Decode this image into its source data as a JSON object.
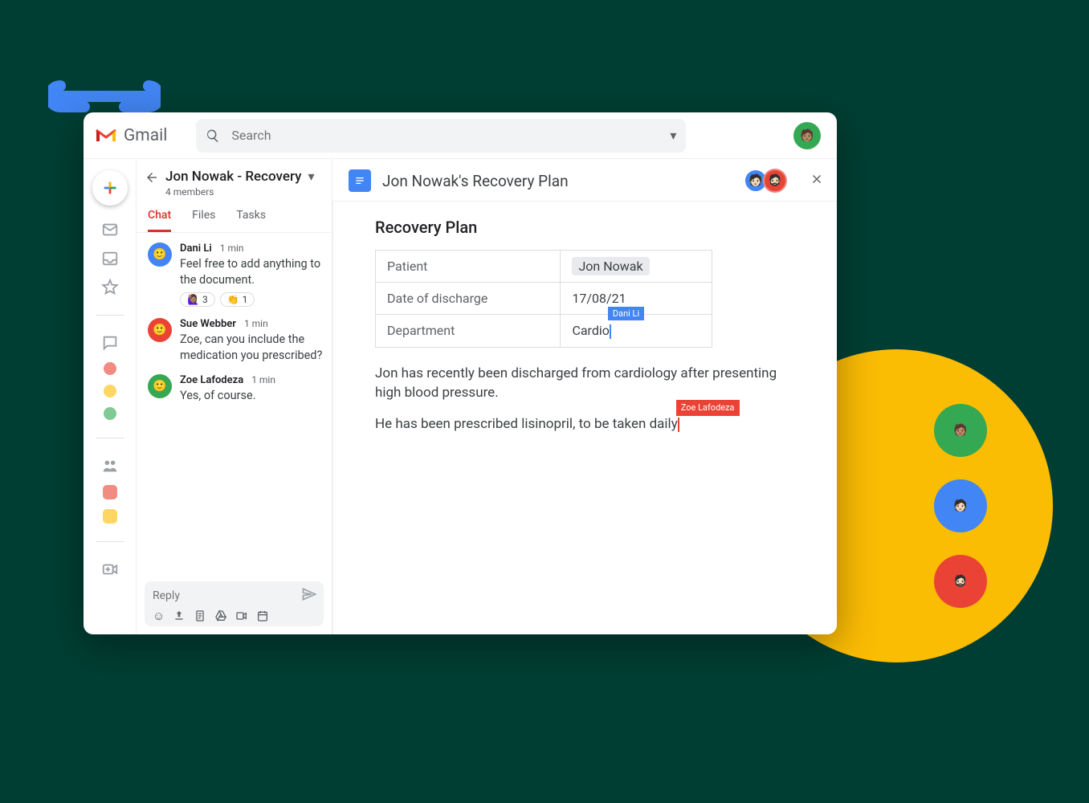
{
  "header": {
    "app_name": "Gmail",
    "search_placeholder": "Search"
  },
  "space": {
    "title": "Jon Nowak - Recovery",
    "subtitle": "4 members",
    "tabs": [
      "Chat",
      "Files",
      "Tasks"
    ],
    "active_tab": "Chat"
  },
  "messages": [
    {
      "author": "Dani Li",
      "time": "1 min",
      "text": "Feel free to add anything to the document.",
      "avatar_color": "#4285f4",
      "reactions": [
        {
          "emoji": "🙋🏽‍♀️",
          "count": "3"
        },
        {
          "emoji": "👏",
          "count": "1"
        }
      ]
    },
    {
      "author": "Sue Webber",
      "time": "1 min",
      "text": "Zoe, can you include the medication you prescribed?",
      "avatar_color": "#ea4335",
      "reactions": []
    },
    {
      "author": "Zoe Lafodeza",
      "time": "1 min",
      "text": "Yes, of course.",
      "avatar_color": "#34a853",
      "reactions": []
    }
  ],
  "reply": {
    "placeholder": "Reply"
  },
  "doc": {
    "title": "Jon Nowak's Recovery Plan",
    "heading": "Recovery Plan",
    "rows": [
      {
        "label": "Patient",
        "value": "Jon Nowak",
        "chip": true
      },
      {
        "label": "Date of discharge",
        "value": "17/08/21"
      },
      {
        "label": "Department",
        "value": "Cardio",
        "cursor": {
          "user": "Dani Li",
          "color": "blue"
        }
      }
    ],
    "paragraph1": "Jon has recently been discharged from cardiology after presenting high blood pressure.",
    "paragraph2_a": "He has been prescribed lisinopril, to be taken daily",
    "paragraph2_cursor_user": "Zoe Lafodeza",
    "collaborators": [
      {
        "color": "#4285f4"
      },
      {
        "color": "#ea4335"
      }
    ]
  },
  "decorative_avatars": [
    {
      "color": "#34a853"
    },
    {
      "color": "#4285f4"
    },
    {
      "color": "#ea4335"
    }
  ]
}
